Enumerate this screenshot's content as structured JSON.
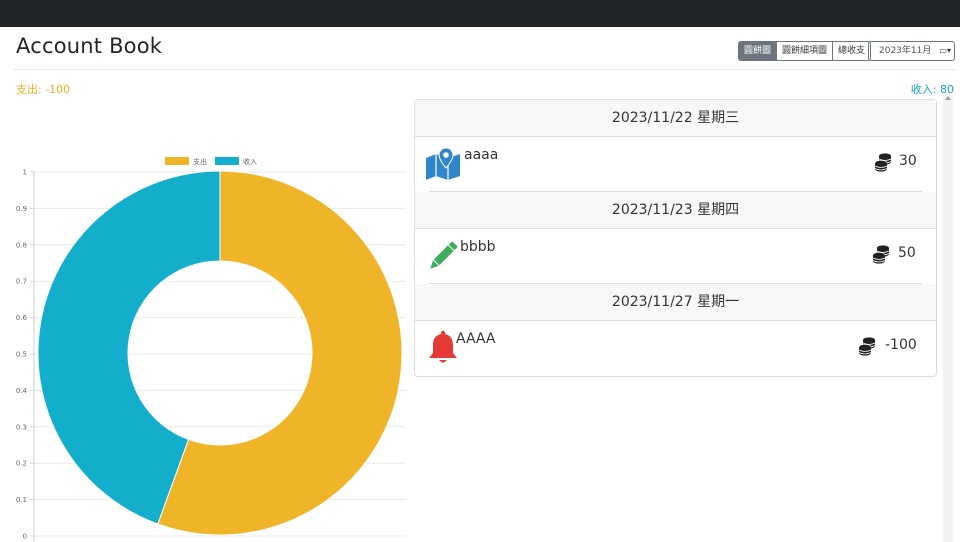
{
  "header": {
    "title": "Account Book"
  },
  "toolbar": {
    "buttons": [
      {
        "label": "圓餅圖",
        "active": true
      },
      {
        "label": "圓餅細項圖",
        "active": false
      },
      {
        "label": "總收支",
        "active": false
      }
    ],
    "month_value": "2023年11月"
  },
  "summary": {
    "expense_label": "支出: -100",
    "income_label": "收入: 80"
  },
  "entries": {
    "groups": [
      {
        "date": "2023/11/22 星期三",
        "items": [
          {
            "name": "aaaa",
            "icon": "map-icon",
            "amount": "30"
          }
        ]
      },
      {
        "date": "2023/11/23 星期四",
        "items": [
          {
            "name": "bbbb",
            "icon": "pencil-icon",
            "amount": "50"
          }
        ]
      },
      {
        "date": "2023/11/27 星期一",
        "items": [
          {
            "name": "AAAA",
            "icon": "bell-icon",
            "amount": "-100"
          }
        ]
      }
    ]
  },
  "colors": {
    "expense": "#f0b429",
    "income": "#14aecd",
    "map": "#2f86c9",
    "pencil": "#3fae5c",
    "bell": "#e53935"
  },
  "chart_data": {
    "type": "doughnut",
    "categories": [
      "支出",
      "收入"
    ],
    "values": [
      100,
      80
    ],
    "colors": [
      "#f0b429",
      "#14aecd"
    ],
    "legend": "top",
    "y_ticks": [
      "1",
      "0.9",
      "0.8",
      "0.7",
      "0.6",
      "0.5",
      "0.4",
      "0.3",
      "0.2",
      "0.1",
      "0"
    ],
    "ylim": [
      0,
      1
    ],
    "grid": true
  }
}
